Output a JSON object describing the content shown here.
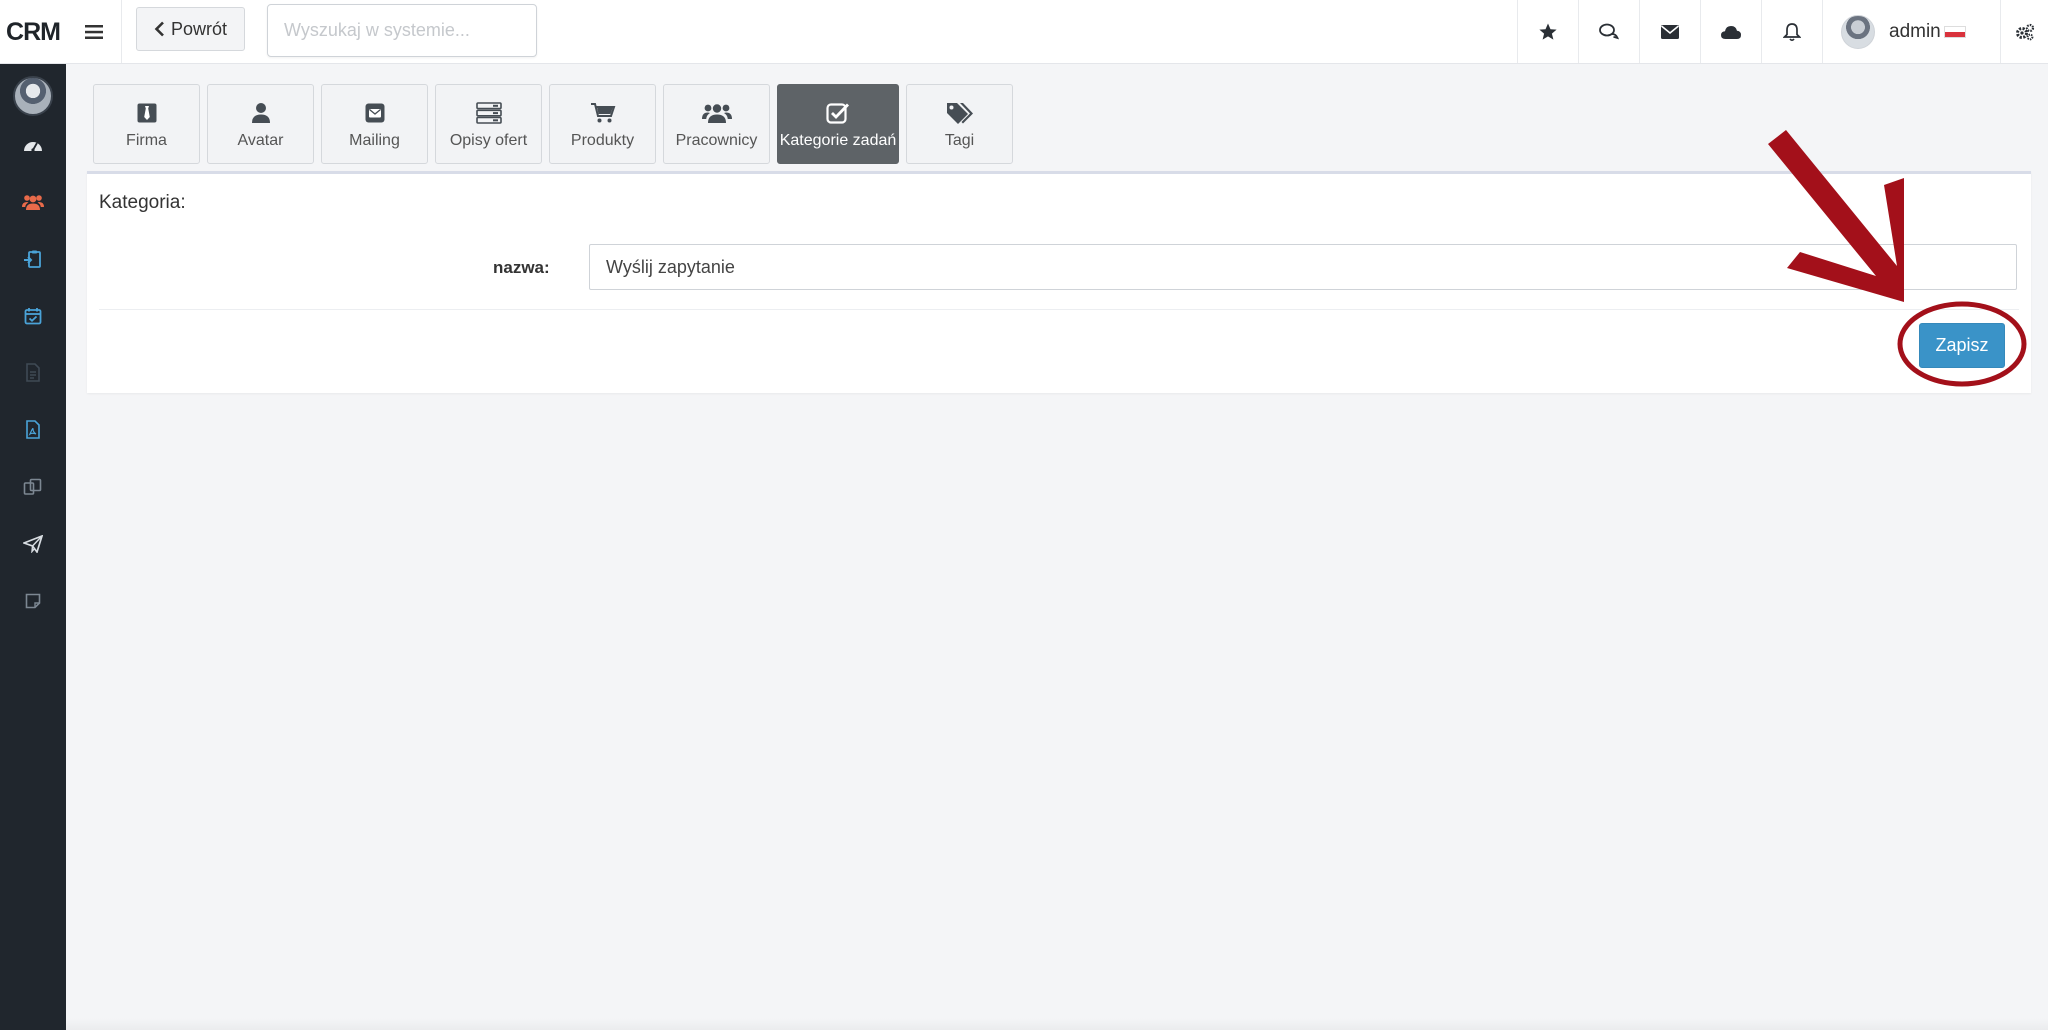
{
  "topbar": {
    "brand": "CRM",
    "back_label": "Powrót",
    "search_placeholder": "Wyszukaj w systemie...",
    "username": "admin",
    "icons": [
      "star-icon",
      "chat-icon",
      "envelope-icon",
      "cloud-icon",
      "bell-icon",
      "cogs-icon"
    ]
  },
  "sidebar": {
    "items": [
      {
        "icon": "dashboard-icon",
        "color": "#e4e7ea"
      },
      {
        "icon": "users-icon",
        "color": "#e86a4a"
      },
      {
        "icon": "clipboard-icon",
        "color": "#4aa3d8"
      },
      {
        "icon": "calendar-check-icon",
        "color": "#4aa3d8"
      },
      {
        "icon": "document-icon",
        "color": "#3f4a55"
      },
      {
        "icon": "pdf-icon",
        "color": "#4aa3d8"
      },
      {
        "icon": "copy-icon",
        "color": "#7c8792"
      },
      {
        "icon": "send-icon",
        "color": "#d8dde2"
      },
      {
        "icon": "note-icon",
        "color": "#7c8792"
      }
    ]
  },
  "tabs": [
    {
      "label": "Firma",
      "icon": "tie-icon",
      "active": false
    },
    {
      "label": "Avatar",
      "icon": "user-icon",
      "active": false
    },
    {
      "label": "Mailing",
      "icon": "mail-icon",
      "active": false
    },
    {
      "label": "Opisy ofert",
      "icon": "server-icon",
      "active": false
    },
    {
      "label": "Produkty",
      "icon": "cart-icon",
      "active": false
    },
    {
      "label": "Pracownicy",
      "icon": "group-icon",
      "active": false
    },
    {
      "label": "Kategorie zadań",
      "icon": "check-square-icon",
      "active": true
    },
    {
      "label": "Tagi",
      "icon": "tags-icon",
      "active": false
    }
  ],
  "form": {
    "title": "Kategoria:",
    "name_label": "nazwa:",
    "name_value": "Wyślij zapytanie",
    "save_label": "Zapisz"
  },
  "colors": {
    "sidebar_bg": "#20262d",
    "accent": "#3a93c8",
    "active_tab": "#5e6367",
    "annotation": "#a3101a"
  }
}
